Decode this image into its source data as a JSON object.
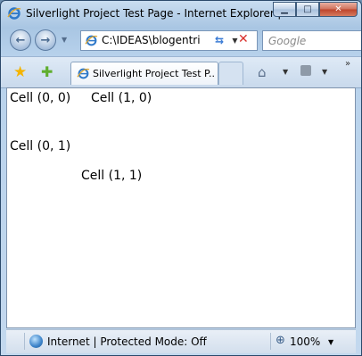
{
  "window": {
    "title": "Silverlight Project Test Page - Internet Explorer pr...",
    "minimize_glyph": "▁",
    "maximize_glyph": "□",
    "close_glyph": "✕"
  },
  "navigation": {
    "back_glyph": "←",
    "forward_glyph": "→",
    "address": "C:\\IDEAS\\blogentri",
    "refresh_glyph": "⇆",
    "stop_glyph": "✕",
    "search_placeholder": "Google"
  },
  "tabs": [
    {
      "label": "Silverlight Project Test P..."
    }
  ],
  "toolbar": {
    "favorites_glyph": "★",
    "add_favorites_glyph": "✚",
    "home_glyph": "⌂",
    "overflow_glyph": "»"
  },
  "content": {
    "cells": [
      {
        "text": "Cell (0, 0)"
      },
      {
        "text": "Cell (1, 0)"
      },
      {
        "text": "Cell (0, 1)"
      },
      {
        "text": "Cell (1, 1)"
      }
    ]
  },
  "status": {
    "zone": "Internet | Protected Mode: Off",
    "zoom": "100%",
    "zoom_glyph": "⊕"
  },
  "colors": {
    "frame": "#a9c6e3",
    "close_button": "#bd432a",
    "content_background": "#ffffff"
  }
}
